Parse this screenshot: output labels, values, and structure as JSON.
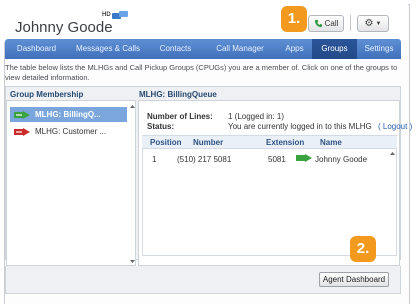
{
  "header": {
    "user_name": "Johnny Goode",
    "hd_tag": "HD",
    "call_label": "Call",
    "callout_1": "1.",
    "callout_2": "2."
  },
  "nav": {
    "tabs": [
      {
        "label": "Dashboard",
        "active": false
      },
      {
        "label": "Messages & Calls",
        "active": false
      },
      {
        "label": "Contacts",
        "active": false
      },
      {
        "label": "Call Manager",
        "active": false
      },
      {
        "label": "Apps",
        "active": false
      },
      {
        "label": "Groups",
        "active": true
      },
      {
        "label": "Settings",
        "active": false
      }
    ]
  },
  "description": "The table below lists the MLHGs and Call Pickup Groups (CPUGs) you are a member of. Click on one of the groups to view detailed information.",
  "group_membership": {
    "title": "Group Membership",
    "items": [
      {
        "label": "MLHG: BillingQ...",
        "selected": true,
        "icon": "green-arrow-icon"
      },
      {
        "label": "MLHG: Customer ...",
        "selected": false,
        "icon": "red-arrow-icon"
      }
    ]
  },
  "queue": {
    "title": "MLHG: BillingQueue",
    "lines_label": "Number of Lines:",
    "lines_value": "1  (Logged in: 1)",
    "status_label": "Status:",
    "status_value": "You are currently logged in to this MLHG",
    "logout_label": "( Logout )",
    "columns": [
      "Position",
      "Number",
      "Extension",
      "Name"
    ],
    "rows": [
      {
        "position": "1",
        "number": "(510) 217 5081",
        "extension": "5081",
        "name": "Johnny Goode"
      }
    ]
  },
  "footer": {
    "agent_dashboard_label": "Agent Dashboard"
  },
  "colors": {
    "nav": "#4a7cc6",
    "accent": "#f39a1e",
    "selected": "#7aa6dd"
  }
}
